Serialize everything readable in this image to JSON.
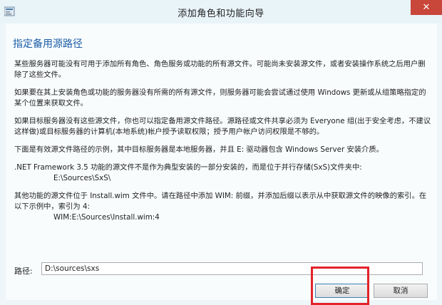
{
  "window": {
    "title": "添加角色和功能向导",
    "close_label": "✕"
  },
  "dialog": {
    "heading": "指定备用源路径",
    "paragraphs": [
      "某些服务器可能没有可用于添加所有角色、角色服务或功能的所有源文件。可能尚未安装源文件，或者安装操作系统之后用户删除了这些文件。",
      "如果要在其上安装角色或功能的服务器没有所需的所有源文件，则服务器可能会尝试通过使用 Windows 更新或从组策略指定的某个位置来获取文件。",
      "如果目标服务器没有这些源文件，你也可以指定备用源文件路径。源路径或文件共享必须为 Everyone 组(出于安全考虑，不建议这样做)或目标服务器的计算机(本地系统)帐户授予读取权限；授予用户帐户访问权限是不够的。",
      "下面是有效源文件路径的示例，其中目标服务器是本地服务器，并且 E: 驱动器包含 Windows Server 安装介质。"
    ],
    "netfx_text": ".NET Framework 3.5 功能的源文件不是作为典型安装的一部分安装的，而是位于并行存储(SxS)文件夹中:",
    "netfx_example": "E:\\Sources\\SxS\\",
    "wim_text": "其他功能的源文件位于 Install.wim 文件中。请在路径中添加 WIM: 前缀，并添加后缀以表示从中获取源文件的映像的索引。在以下示例中，索引为 4:",
    "wim_example": "WIM:E:\\Sources\\Install.wim:4",
    "path_label": "路径:",
    "path_value": "D:\\sources\\sxs",
    "ok_label": "确定",
    "cancel_label": "取消"
  },
  "colors": {
    "heading": "#1a5da8",
    "close_button": "#c9463a",
    "highlight_box": "#e3222b"
  },
  "icons": [
    "wizard-app-icon",
    "close-icon"
  ]
}
